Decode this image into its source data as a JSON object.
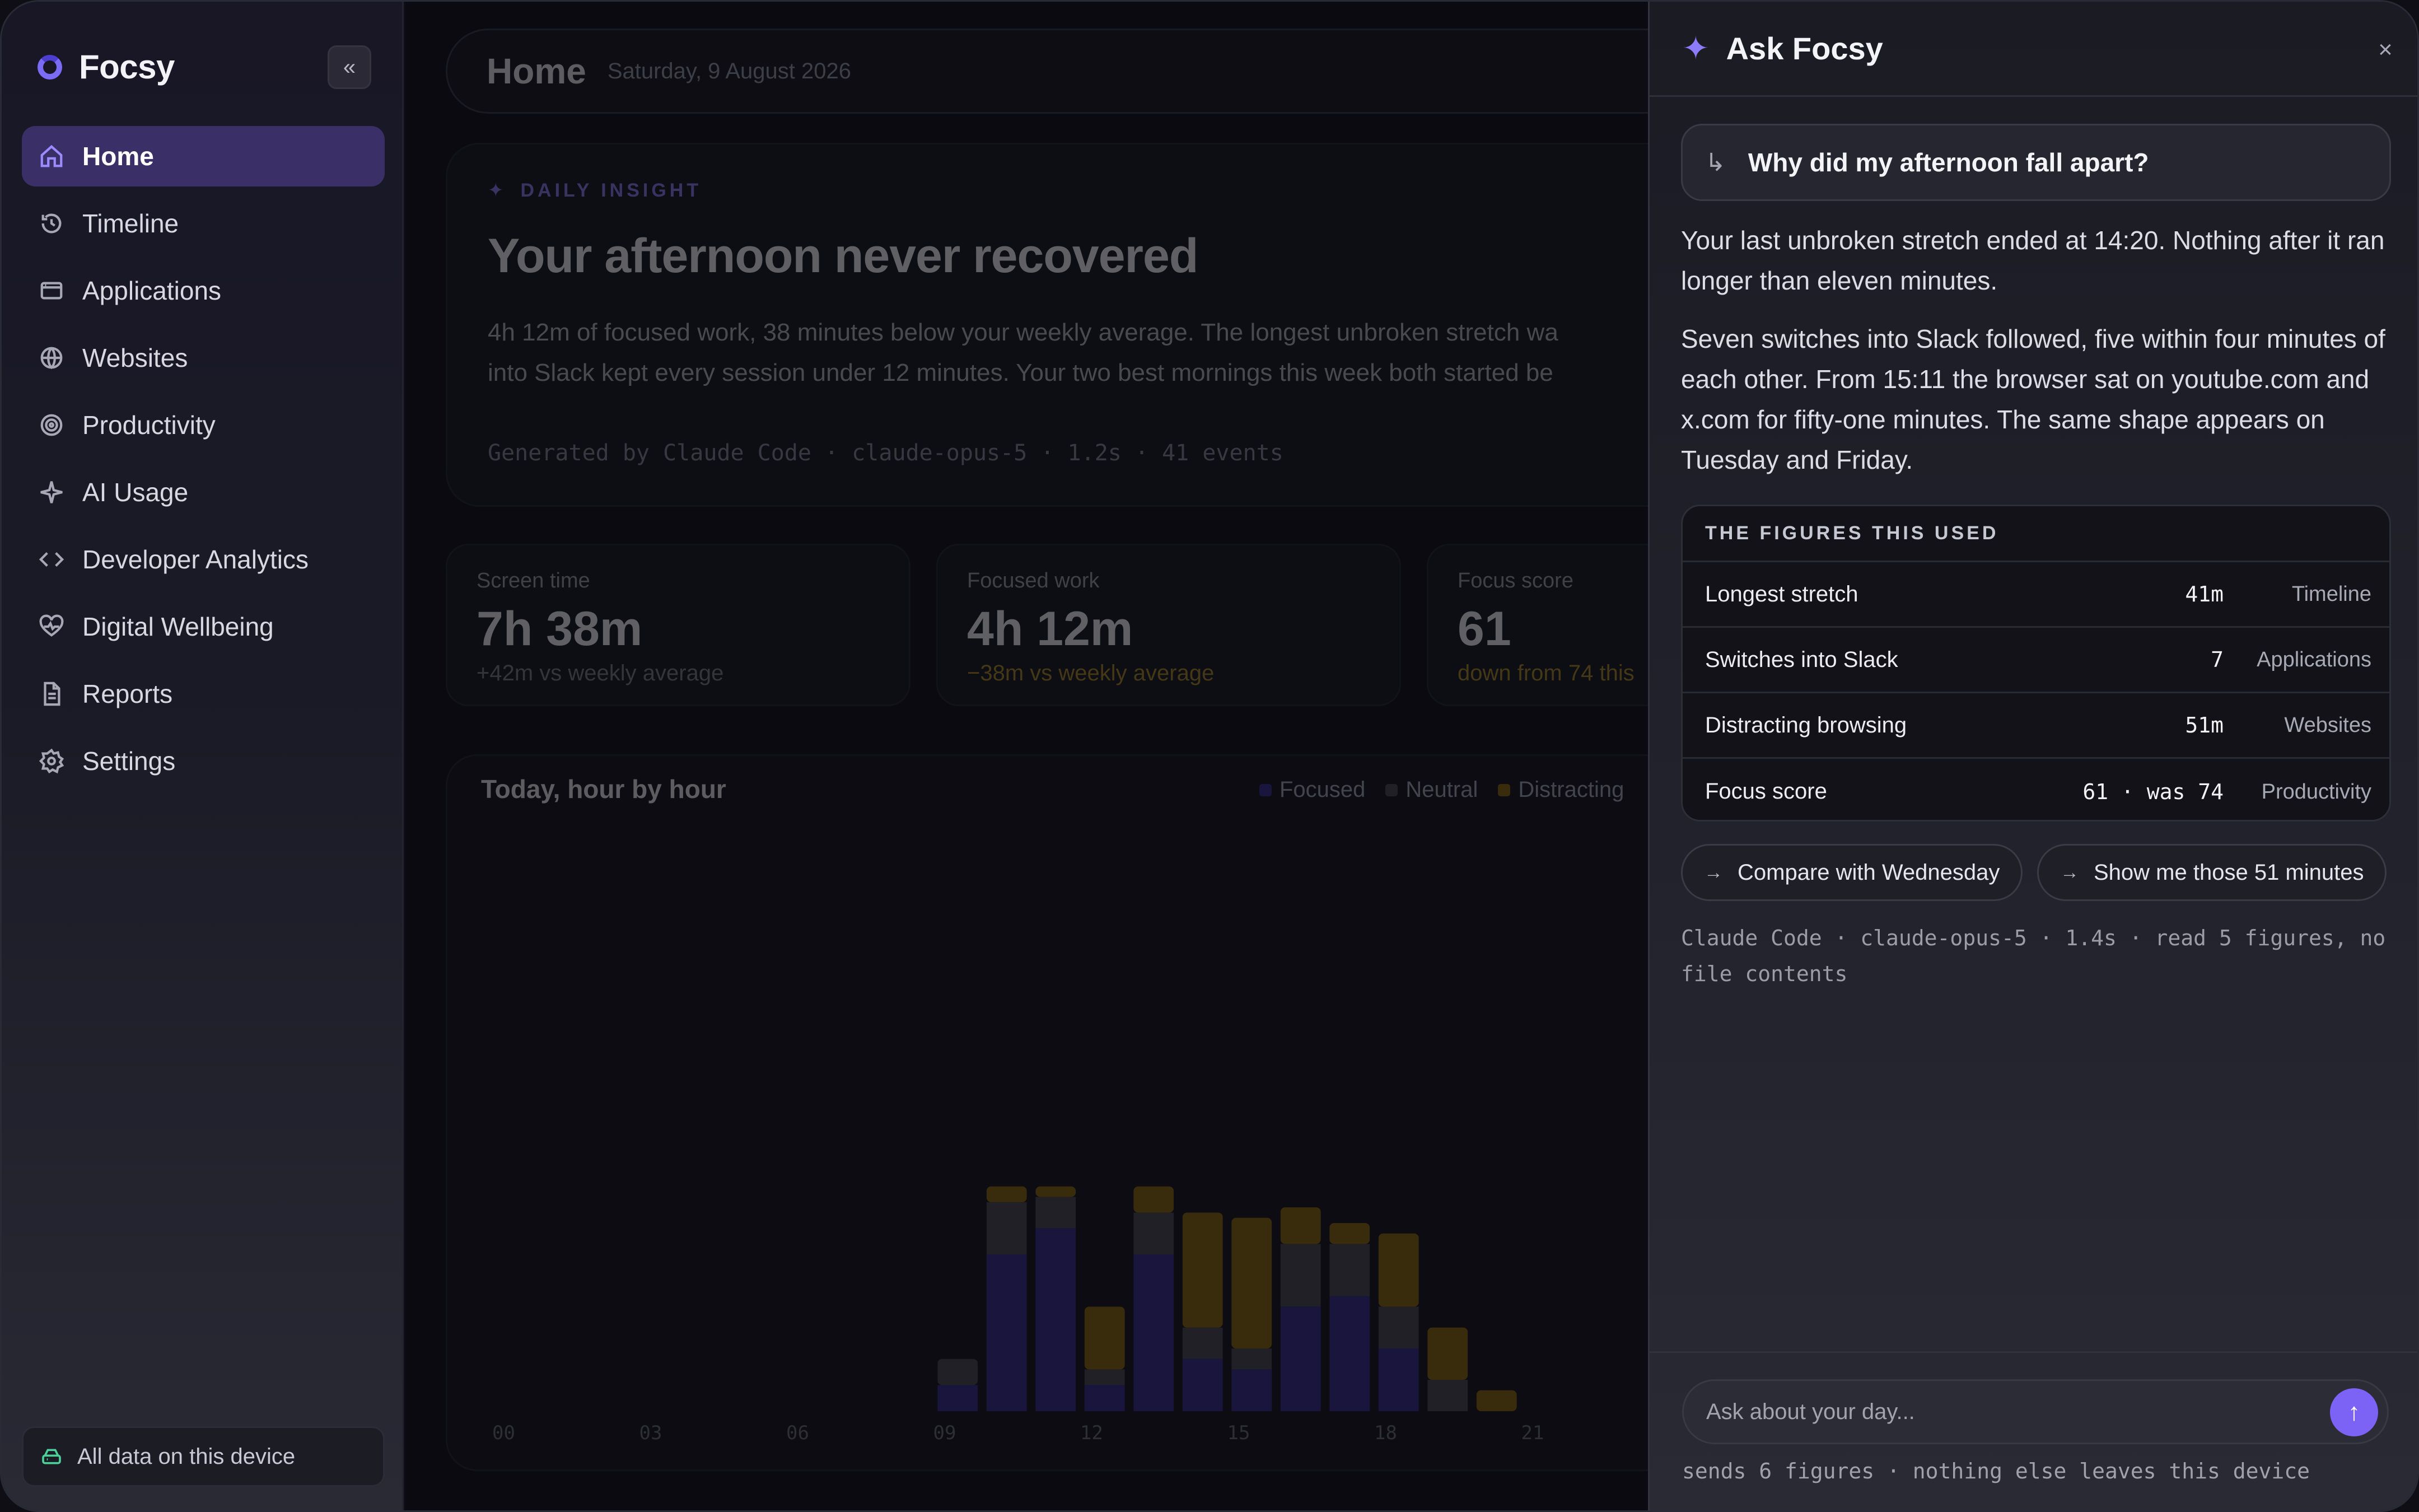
{
  "app": {
    "name": "Focsy",
    "collapse_icon": "«"
  },
  "sidebar": {
    "items": [
      {
        "label": "Home",
        "icon": "home-icon",
        "active": true
      },
      {
        "label": "Timeline",
        "icon": "history-icon"
      },
      {
        "label": "Applications",
        "icon": "window-icon"
      },
      {
        "label": "Websites",
        "icon": "globe-icon"
      },
      {
        "label": "Productivity",
        "icon": "target-icon"
      },
      {
        "label": "AI Usage",
        "icon": "sparkle-icon"
      },
      {
        "label": "Developer Analytics",
        "icon": "code-icon"
      },
      {
        "label": "Digital Wellbeing",
        "icon": "heart-pulse-icon"
      },
      {
        "label": "Reports",
        "icon": "document-icon"
      },
      {
        "label": "Settings",
        "icon": "gear-icon"
      }
    ],
    "device_badge": "All data on this device"
  },
  "main": {
    "header": {
      "title": "Home",
      "date": "Saturday, 9 August 2026"
    },
    "insight": {
      "kicker": "DAILY INSIGHT",
      "title": "Your afternoon never recovered",
      "body_line1": "4h 12m of focused work, 38 minutes below your weekly average. The longest unbroken stretch wa",
      "body_line2": "into Slack kept every session under 12 minutes. Your two best mornings this week both started be",
      "meta": "Generated by Claude Code · claude-opus-5 · 1.2s · 41 events"
    },
    "stats": [
      {
        "label": "Screen time",
        "value": "7h 38m",
        "delta": "+42m vs weekly average",
        "delta_color": "#7f7f8c"
      },
      {
        "label": "Focused work",
        "value": "4h 12m",
        "delta": "−38m vs weekly average",
        "delta_color": "#a9882a"
      },
      {
        "label": "Focus score",
        "value": "61",
        "delta": "down from 74 this",
        "delta_color": "#a9882a"
      }
    ]
  },
  "chart_data": {
    "type": "bar",
    "stacked": true,
    "title": "Today, hour by hour",
    "x_ticks": [
      "00",
      "03",
      "06",
      "09",
      "12",
      "15",
      "18",
      "21"
    ],
    "categories": [
      "09",
      "10",
      "11",
      "12",
      "13",
      "14",
      "15",
      "16",
      "17",
      "18",
      "19",
      "20",
      "21",
      "22"
    ],
    "series": [
      {
        "name": "Focused",
        "color": "#3b2f8f",
        "values": [
          5,
          30,
          35,
          5,
          30,
          10,
          8,
          20,
          22,
          12,
          0,
          0,
          0,
          0
        ]
      },
      {
        "name": "Neutral",
        "color": "#4a4a55",
        "values": [
          5,
          10,
          6,
          3,
          8,
          6,
          4,
          12,
          10,
          8,
          6,
          0,
          0,
          0
        ]
      },
      {
        "name": "Distracting",
        "color": "#8a6a14",
        "values": [
          0,
          3,
          2,
          12,
          5,
          22,
          25,
          7,
          4,
          14,
          10,
          4,
          0,
          0
        ]
      }
    ],
    "legend": [
      "Focused",
      "Neutral",
      "Distracting"
    ],
    "ylim": [
      0,
      60
    ]
  },
  "panel": {
    "title": "Ask Focsy",
    "close_icon": "×",
    "question": "Why did my afternoon fall apart?",
    "answer_p1": "Your last unbroken stretch ended at 14:20. Nothing after it ran longer than eleven minutes.",
    "answer_p2": "Seven switches into Slack followed, five within four minutes of each other. From 15:11 the browser sat on youtube.com and x.com for fifty-one minutes. The same shape appears on Tuesday and Friday.",
    "figures_title": "THE FIGURES THIS USED",
    "figures": [
      {
        "label": "Longest stretch",
        "value": "41m",
        "source": "Timeline"
      },
      {
        "label": "Switches into Slack",
        "value": "7",
        "source": "Applications"
      },
      {
        "label": "Distracting browsing",
        "value": "51m",
        "source": "Websites"
      },
      {
        "label": "Focus score",
        "value": "61 · was 74",
        "source": "Productivity"
      }
    ],
    "chips": [
      "Compare with Wednesday",
      "Show me those 51 minutes"
    ],
    "meta": "Claude Code · claude-opus-5 · 1.4s · read 5 figures, no file contents",
    "composer_placeholder": "Ask about your day...",
    "composer_note": "sends 6 figures · nothing else leaves this device",
    "accent": "#7c63f5"
  }
}
